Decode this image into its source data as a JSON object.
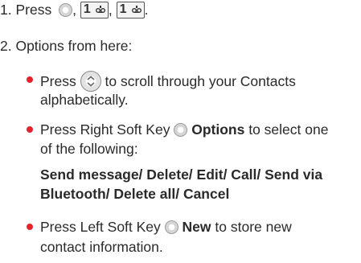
{
  "colors": {
    "bullet": "#e3242b",
    "text": "#2a2a2a"
  },
  "step1": {
    "number": "1. Press",
    "sep1": ",",
    "sep2": ",",
    "end": ".",
    "icons": [
      "softkey-center-icon",
      "key-1-voicemail-icon",
      "key-1-voicemail-icon"
    ],
    "key_digit": "1"
  },
  "step2": {
    "text": "2. Options from here:"
  },
  "bullets": [
    {
      "press": "Press",
      "icon": "navigation-key-icon",
      "line1_rest": "to scroll through your Contacts",
      "line2": "alphabetically."
    },
    {
      "pre": "Press Right Soft Key",
      "icon": "right-softkey-icon",
      "key_label": "Options",
      "post": "to select one",
      "line2": "of the following:",
      "options_line1": "Send message/ Delete/ Edit/ Call/ Send via",
      "options_line2": "Bluetooth/ Delete all/ Cancel"
    },
    {
      "pre": "Press Left Soft Key",
      "icon": "left-softkey-icon",
      "key_label": "New",
      "post": "to store new",
      "line2": "contact information."
    }
  ]
}
